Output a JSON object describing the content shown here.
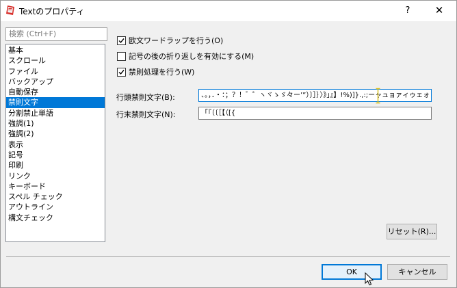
{
  "window": {
    "title": "Textのプロパティ",
    "help_label": "?",
    "close_label": "✕",
    "accent_color": "#0078d7"
  },
  "sidebar": {
    "search_placeholder": "検索 (Ctrl+F)",
    "items": [
      {
        "label": "基本"
      },
      {
        "label": "スクロール"
      },
      {
        "label": "ファイル"
      },
      {
        "label": "バックアップ"
      },
      {
        "label": "自動保存"
      },
      {
        "label": "禁則文字",
        "selected": true
      },
      {
        "label": "分割禁止単語"
      },
      {
        "label": "強調(1)"
      },
      {
        "label": "強調(2)"
      },
      {
        "label": "表示"
      },
      {
        "label": "記号"
      },
      {
        "label": "印刷"
      },
      {
        "label": "リンク"
      },
      {
        "label": "キーボード"
      },
      {
        "label": "スペル チェック"
      },
      {
        "label": "アウトライン"
      },
      {
        "label": "構文チェック"
      }
    ]
  },
  "options": {
    "word_wrap": {
      "label": "欧文ワードラップを行う(O)",
      "checked": true
    },
    "hanging_punct": {
      "label": "記号の後の折り返しを有効にする(M)",
      "checked": false
    },
    "kinsoku": {
      "label": "禁則処理を行う(W)",
      "checked": true
    }
  },
  "fields": {
    "line_start": {
      "label": "行頭禁則文字(B):",
      "value": "、。，．・：；？！゛゜ヽヾゝゞ々ー’”）〕］｝〉》」』】!%)]}.,:;ーャュョァィゥェォ"
    },
    "line_end": {
      "label": "行末禁則文字(N):",
      "value": "「『（〔［【（[{"
    }
  },
  "buttons": {
    "reset": "リセット(R)...",
    "ok": "OK",
    "cancel": "キャンセル"
  }
}
